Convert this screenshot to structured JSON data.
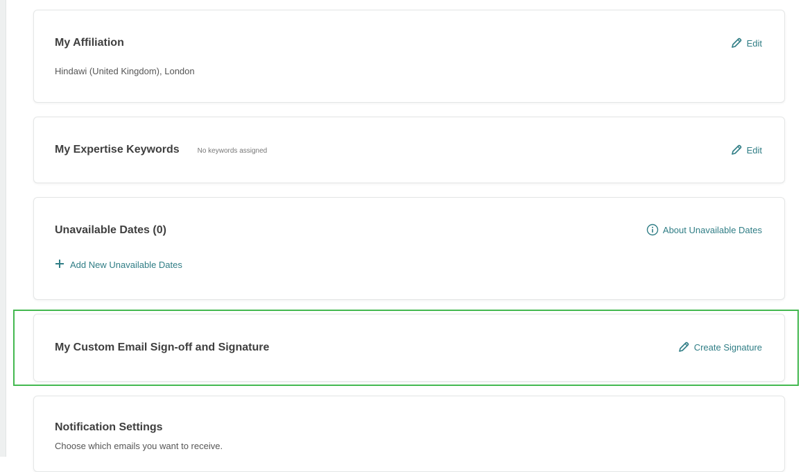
{
  "affiliation": {
    "title": "My Affiliation",
    "value": "Hindawi (United Kingdom), London",
    "edit_label": "Edit"
  },
  "expertise": {
    "title": "My Expertise Keywords",
    "note": "No keywords assigned",
    "edit_label": "Edit"
  },
  "unavailable": {
    "title": "Unavailable Dates (0)",
    "about_label": "About Unavailable Dates",
    "add_label": "Add New Unavailable Dates"
  },
  "signature": {
    "title": "My Custom Email Sign-off and Signature",
    "create_label": "Create Signature"
  },
  "notifications": {
    "title": "Notification Settings",
    "subtitle": "Choose which emails you want to receive."
  },
  "colors": {
    "link": "#2f7d85",
    "highlight": "#43b84f",
    "card_border": "#e4e6e6"
  }
}
